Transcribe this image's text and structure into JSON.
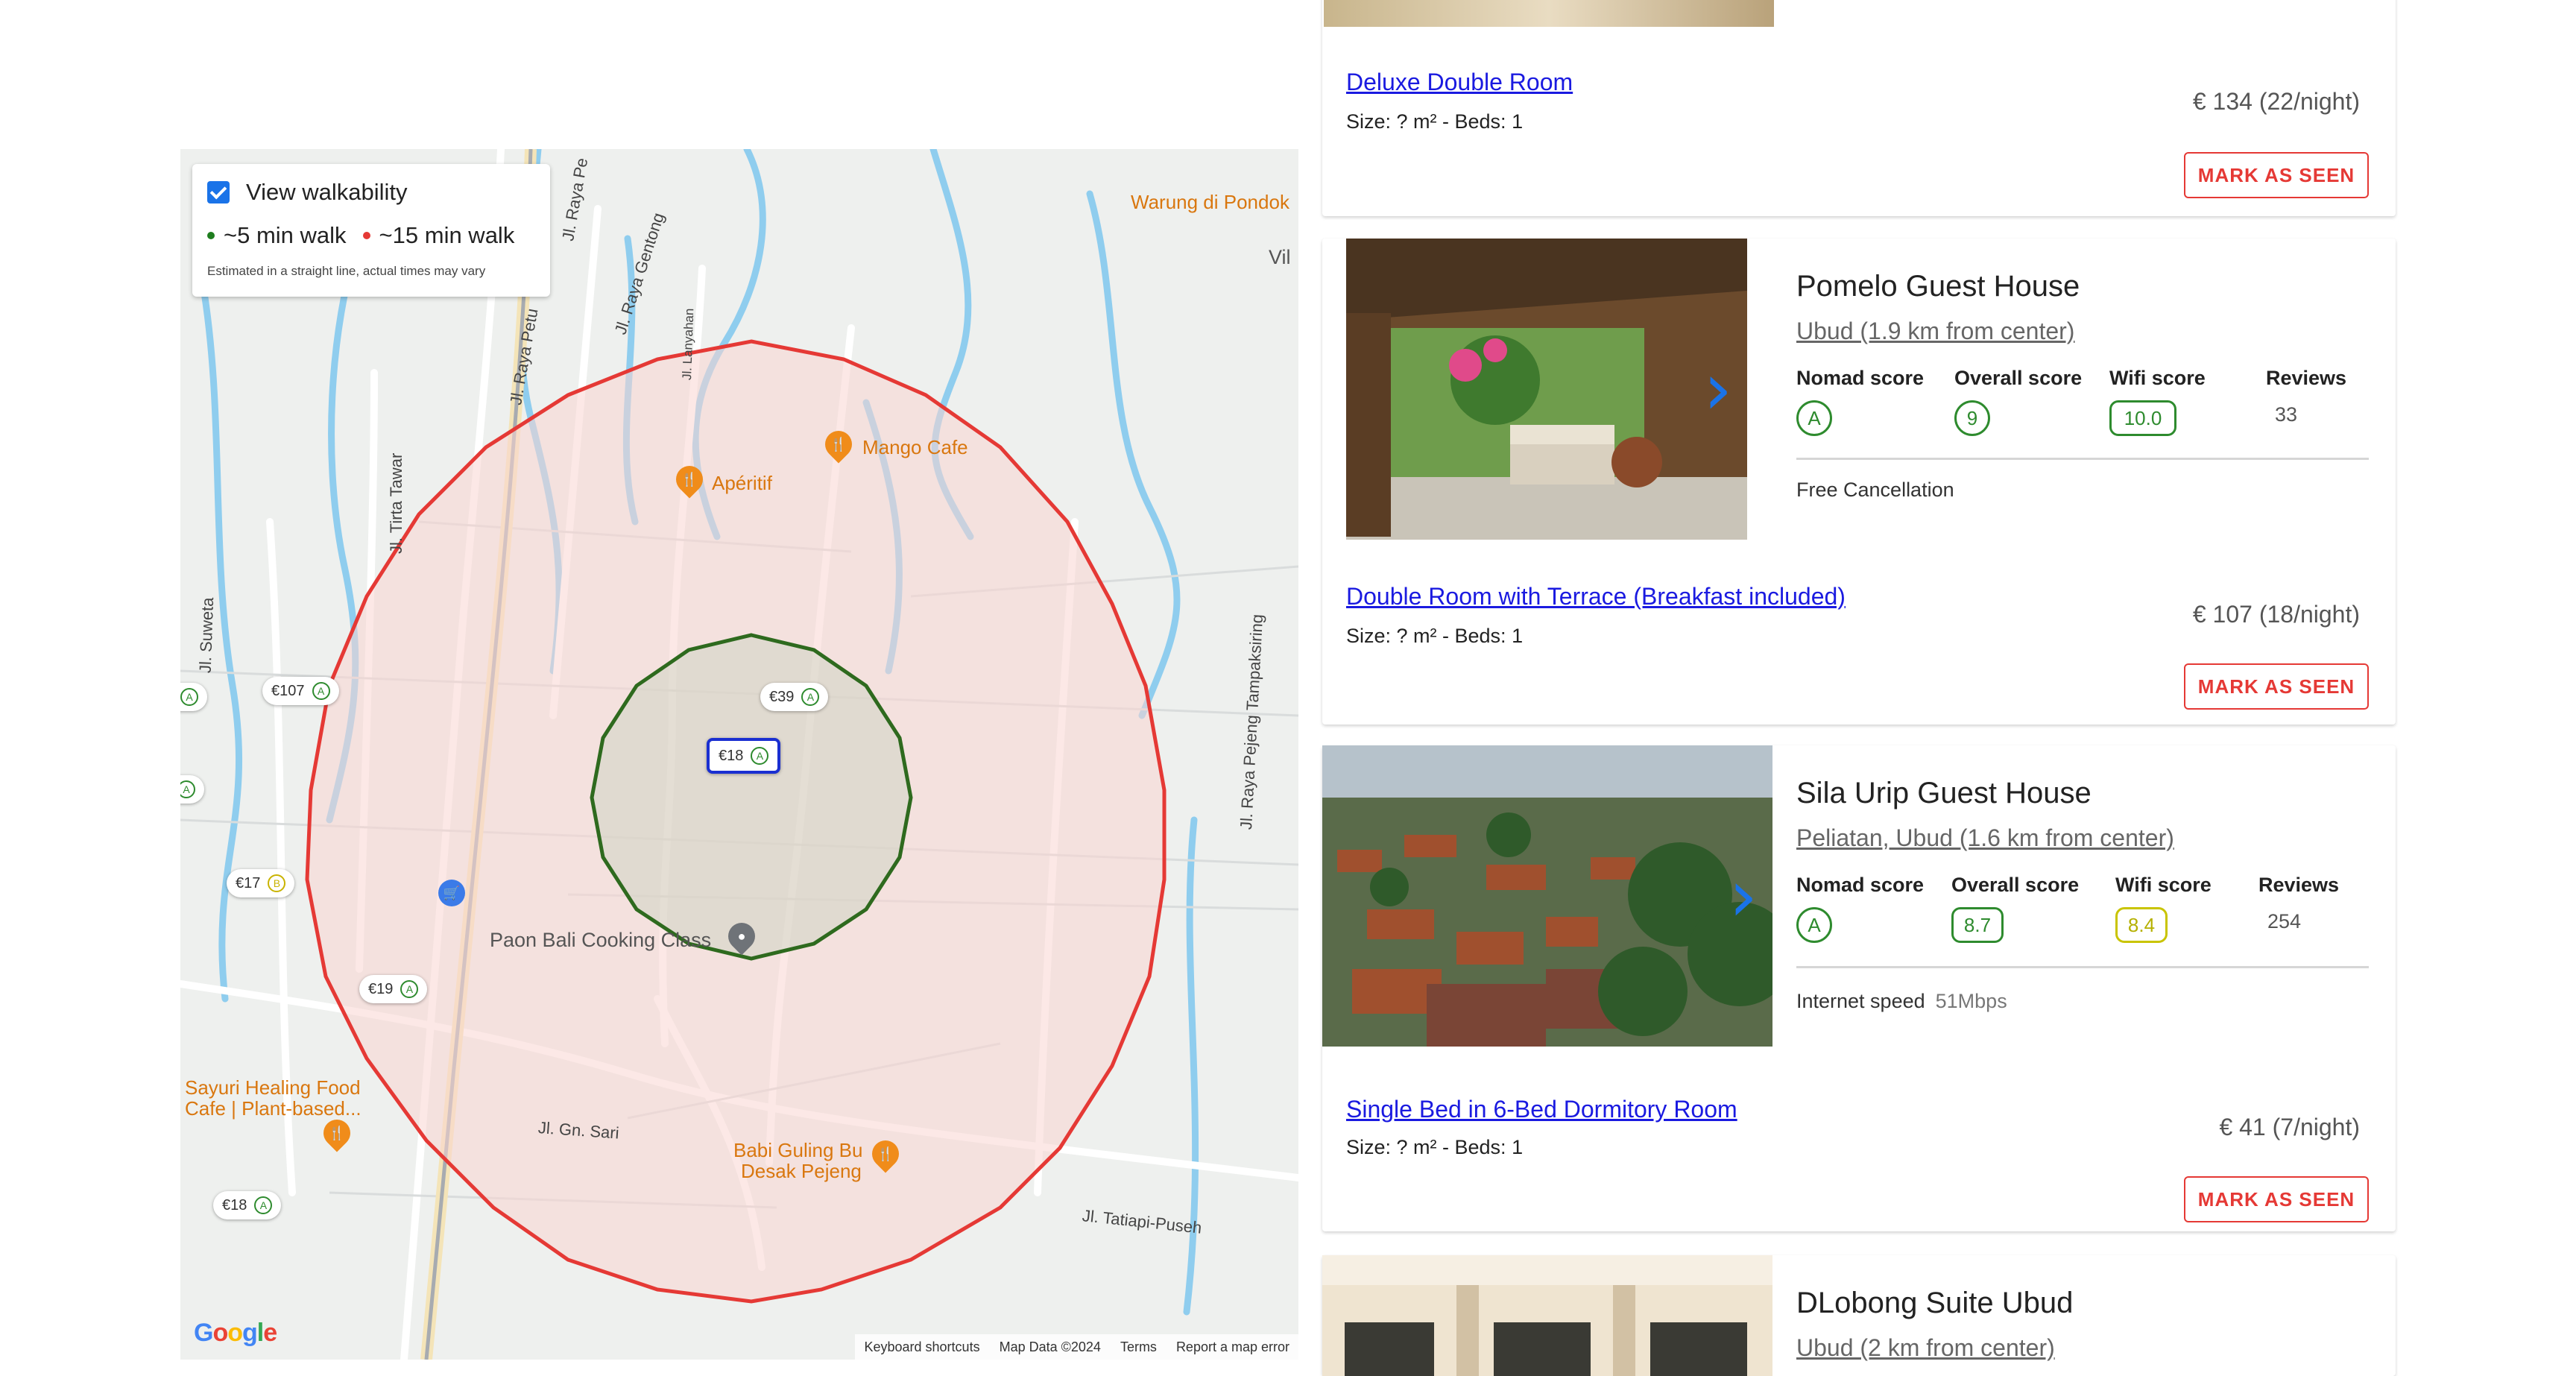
{
  "map": {
    "walkability": {
      "label": "View walkability",
      "five_min": "~5 min walk",
      "fifteen_min": "~15 min walk",
      "note": "Estimated in a straight line, actual times may vary",
      "colors": {
        "five": "#1e7d1e",
        "fifteen": "#e53935"
      }
    },
    "price_pins": [
      {
        "price": "€107",
        "grade": "A"
      },
      {
        "price": "€39",
        "grade": "A"
      },
      {
        "price": "€18",
        "grade": "A"
      },
      {
        "price": "€17",
        "grade": "B"
      },
      {
        "price": "€19",
        "grade": "A"
      },
      {
        "price": "€18",
        "grade": "A"
      },
      {
        "price": "",
        "grade": "A"
      },
      {
        "price": "",
        "grade": "A"
      }
    ],
    "pois": {
      "mango": "Mango Cafe",
      "aperitif": "Apéritif",
      "warung": "Warung di Pondok",
      "vil": "Vil",
      "paon": "Paon Bali Cooking Class",
      "sayuri_1": "Sayuri Healing Food",
      "sayuri_2": "Cafe | Plant-based...",
      "babi_1": "Babi Guling Bu",
      "babi_2": "Desak Pejeng"
    },
    "roads": {
      "gentong": "Jl. Raya Gentong",
      "raya_pe": "Jl. Raya Pe",
      "raya_petu": "Jl. Raya Petu",
      "lanyahan": "Jl. Lanyahan",
      "tirta": "Jl. Tirta Tawar",
      "suweta": "Jl. Suweta",
      "pejeng": "Jl. Raya Pejeng Tampaksiring",
      "gn_sari": "Jl. Gn. Sari",
      "tatiapi": "Jl. Tatiapi-Puseh"
    },
    "logo": "Google",
    "footer": {
      "shortcuts": "Keyboard shortcuts",
      "map_data": "Map Data ©2024",
      "terms": "Terms",
      "report": "Report a map error"
    }
  },
  "score_labels": {
    "nomad": "Nomad score",
    "overall": "Overall score",
    "wifi": "Wifi score",
    "reviews": "Reviews"
  },
  "mark_seen_label": "MARK AS SEEN",
  "listings": [
    {
      "room": "Deluxe Double Room",
      "size": "Size: ? m² - Beds: 1",
      "price": "€ 134 (22/night)"
    },
    {
      "name": "Pomelo Guest House",
      "location": "Ubud (1.9 km from center)",
      "nomad": "A",
      "overall": "9",
      "wifi": "10.0",
      "reviews": "33",
      "feature": "Free Cancellation",
      "room": "Double Room with Terrace (Breakfast included)",
      "size": "Size: ? m² - Beds: 1",
      "price": "€ 107 (18/night)"
    },
    {
      "name": "Sila Urip Guest House",
      "location": "Peliatan, Ubud (1.6 km from center)",
      "nomad": "A",
      "overall": "8.7",
      "wifi": "8.4",
      "reviews": "254",
      "feature": "Internet speed",
      "feature_value": "51Mbps",
      "room": "Single Bed in 6-Bed Dormitory Room",
      "size": "Size: ? m² - Beds: 1",
      "price": "€ 41 (7/night)"
    },
    {
      "name": "DLobong Suite Ubud",
      "location": "Ubud (2 km from center)"
    }
  ],
  "colors": {
    "accent_blue": "#1a73e8",
    "link_blue": "#1a1ae0",
    "score_green": "#2e8b2e",
    "score_yellow": "#c9c400",
    "mark_red": "#e53935"
  }
}
